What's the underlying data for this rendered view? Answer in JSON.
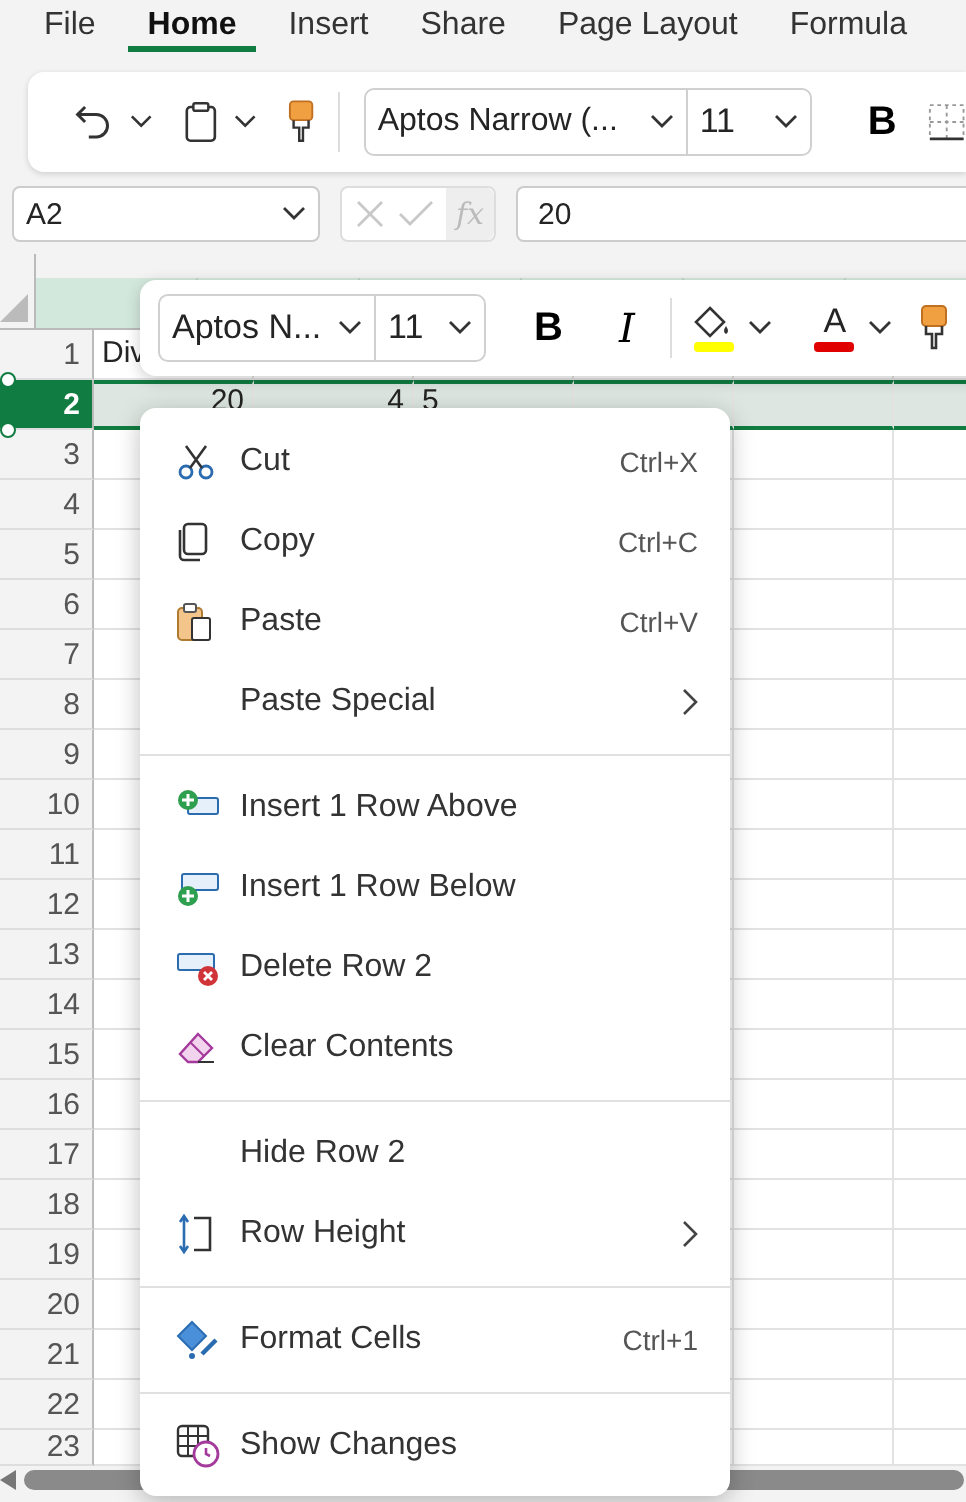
{
  "ribbon_tabs": [
    {
      "label": "File",
      "selected": false
    },
    {
      "label": "Home",
      "selected": true
    },
    {
      "label": "Insert",
      "selected": false
    },
    {
      "label": "Share",
      "selected": false
    },
    {
      "label": "Page Layout",
      "selected": false
    },
    {
      "label": "Formula",
      "selected": false
    }
  ],
  "ribbon": {
    "font": "Aptos Narrow (...",
    "size": "11",
    "bold_label": "B"
  },
  "formula_bar": {
    "name_box": "A2",
    "fx": "fx",
    "value": "20"
  },
  "grid": {
    "rows": [
      {
        "number": "1",
        "selected": false,
        "cells": [
          "Div"
        ]
      },
      {
        "number": "2",
        "selected": true,
        "cells": [
          "20",
          "4",
          "5"
        ]
      },
      {
        "number": "3",
        "selected": false,
        "cells": []
      },
      {
        "number": "4",
        "selected": false,
        "cells": []
      },
      {
        "number": "5",
        "selected": false,
        "cells": []
      },
      {
        "number": "6",
        "selected": false,
        "cells": []
      },
      {
        "number": "7",
        "selected": false,
        "cells": []
      },
      {
        "number": "8",
        "selected": false,
        "cells": []
      },
      {
        "number": "9",
        "selected": false,
        "cells": []
      },
      {
        "number": "10",
        "selected": false,
        "cells": []
      },
      {
        "number": "11",
        "selected": false,
        "cells": []
      },
      {
        "number": "12",
        "selected": false,
        "cells": []
      },
      {
        "number": "13",
        "selected": false,
        "cells": []
      },
      {
        "number": "14",
        "selected": false,
        "cells": []
      },
      {
        "number": "15",
        "selected": false,
        "cells": []
      },
      {
        "number": "16",
        "selected": false,
        "cells": []
      },
      {
        "number": "17",
        "selected": false,
        "cells": []
      },
      {
        "number": "18",
        "selected": false,
        "cells": []
      },
      {
        "number": "19",
        "selected": false,
        "cells": []
      },
      {
        "number": "20",
        "selected": false,
        "cells": []
      },
      {
        "number": "21",
        "selected": false,
        "cells": []
      },
      {
        "number": "22",
        "selected": false,
        "cells": []
      },
      {
        "number": "23",
        "selected": false,
        "cells": []
      }
    ]
  },
  "mini_toolbar": {
    "font": "Aptos N...",
    "size": "11",
    "bold_label": "B",
    "italic_label": "I",
    "font_color_label": "A"
  },
  "context_menu": {
    "groups": [
      [
        {
          "label": "Cut",
          "shortcut": "Ctrl+X",
          "submenu": false
        },
        {
          "label": "Copy",
          "shortcut": "Ctrl+C",
          "submenu": false
        },
        {
          "label": "Paste",
          "shortcut": "Ctrl+V",
          "submenu": false
        },
        {
          "label": "Paste Special",
          "submenu": true
        }
      ],
      [
        {
          "label": "Insert 1 Row Above",
          "submenu": false
        },
        {
          "label": "Insert 1 Row Below",
          "submenu": false
        },
        {
          "label": "Delete Row 2",
          "submenu": false
        },
        {
          "label": "Clear Contents",
          "submenu": false
        }
      ],
      [
        {
          "label": "Hide Row 2",
          "submenu": false
        },
        {
          "label": "Row Height",
          "submenu": true
        }
      ],
      [
        {
          "label": "Format Cells",
          "shortcut": "Ctrl+1",
          "submenu": false
        }
      ],
      [
        {
          "label": "Show Changes",
          "submenu": false
        }
      ]
    ]
  }
}
